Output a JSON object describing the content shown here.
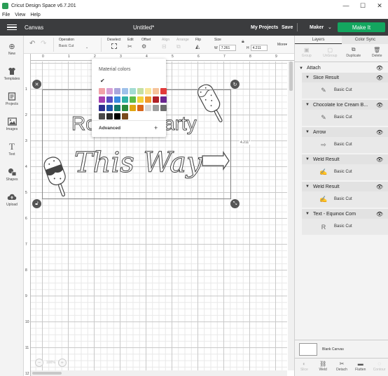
{
  "window": {
    "title": "Cricut Design Space  v6.7.201",
    "minimize": "—",
    "maximize": "☐",
    "close": "✕"
  },
  "menu": [
    "File",
    "View",
    "Help"
  ],
  "header": {
    "section": "Canvas",
    "doc_title": "Untitled*",
    "my_projects": "My Projects",
    "save": "Save",
    "machine": "Maker",
    "make_it": "Make It",
    "accent_color": "#13a65f"
  },
  "leftbar": [
    {
      "label": "New",
      "icon": "plus-icon",
      "glyph": "⊕"
    },
    {
      "label": "Templates",
      "icon": "shirt-icon",
      "glyph": "👕"
    },
    {
      "label": "Projects",
      "icon": "projects-icon",
      "glyph": "▤"
    },
    {
      "label": "Images",
      "icon": "image-icon",
      "glyph": "▨"
    },
    {
      "label": "Text",
      "icon": "text-icon",
      "glyph": "T"
    },
    {
      "label": "Shapes",
      "icon": "shapes-icon",
      "glyph": "◈"
    },
    {
      "label": "Upload",
      "icon": "upload-icon",
      "glyph": "☁"
    }
  ],
  "toolbar": {
    "undo": "↶",
    "redo": "↷",
    "operation_label": "Operation",
    "operation_value": "Basic Cut",
    "deselect": "Deselect",
    "edit": "Edit",
    "offset": "Offset",
    "align": "Align",
    "arrange": "Arrange",
    "flip": "Flip",
    "size": "Size",
    "w_label": "W",
    "w_value": "7.261",
    "h_label": "H",
    "h_value": "4.211",
    "more": "More▾"
  },
  "ruler_top": [
    "0",
    "1",
    "2",
    "3",
    "4",
    "5",
    "6",
    "7",
    "8",
    "9"
  ],
  "ruler_left": [
    "1",
    "2",
    "3",
    "4",
    "5",
    "6",
    "7",
    "8",
    "9",
    "10",
    "11",
    "12"
  ],
  "canvas": {
    "dimension_label": "4.211\"",
    "design_text_1": "Ro",
    "design_text_2": "arty",
    "design_script": "This Way"
  },
  "popup": {
    "title": "Material colors",
    "advanced": "Advanced",
    "check": "✔",
    "plus": "+",
    "swatches": [
      "#f2a2a8",
      "#d7a0d6",
      "#a9a6dc",
      "#9ec1ea",
      "#a3dcd3",
      "#c5e0a2",
      "#f8e69a",
      "#f6c39b",
      "#e23a3a",
      "#a63fb0",
      "#5a4fc2",
      "#3a8be0",
      "#2fb1a6",
      "#5fbb46",
      "#f3d23b",
      "#f19a30",
      "#b12027",
      "#6a2590",
      "#2c2f8f",
      "#1f56a8",
      "#137a6b",
      "#2c8a3c",
      "#e0a512",
      "#d9661a",
      "#d6d6d6",
      "#9e9e9e",
      "#6d6d6d",
      "#4a4a4a",
      "#2a2a2a",
      "#000000",
      "#7a4a1c",
      ""
    ]
  },
  "right_panel": {
    "tabs": [
      "Layers",
      "Color Sync"
    ],
    "actions": [
      {
        "label": "Group",
        "icon": "group-icon",
        "disabled": true
      },
      {
        "label": "UnGroup",
        "icon": "ungroup-icon",
        "disabled": true
      },
      {
        "label": "Duplicate",
        "icon": "duplicate-icon",
        "disabled": false
      },
      {
        "label": "Delete",
        "icon": "delete-icon",
        "disabled": false
      }
    ],
    "attach_label": "Attach",
    "layers": [
      {
        "name": "Slice Result",
        "child": "Basic Cut",
        "thumb": "✎"
      },
      {
        "name": "Chocolate Ice Cream B...",
        "child": "Basic Cut",
        "thumb": "✎"
      },
      {
        "name": "Arrow",
        "child": "Basic Cut",
        "thumb": "⇨"
      },
      {
        "name": "Weld Result",
        "child": "Basic Cut",
        "thumb": "✍"
      },
      {
        "name": "Weld Result",
        "child": "Basic Cut",
        "thumb": "✍"
      },
      {
        "name": "Text - Equinox Com",
        "child": "Basic Cut",
        "thumb": "R"
      }
    ],
    "blank_canvas": "Blank Canvas",
    "bottom_actions": [
      {
        "label": "Slice",
        "icon": "slice-icon",
        "disabled": true
      },
      {
        "label": "Weld",
        "icon": "weld-icon",
        "disabled": false
      },
      {
        "label": "Detach",
        "icon": "detach-icon",
        "disabled": false
      },
      {
        "label": "Flatten",
        "icon": "flatten-icon",
        "disabled": false
      },
      {
        "label": "Contour",
        "icon": "contour-icon",
        "disabled": true
      }
    ]
  },
  "zoom": {
    "value": "100%",
    "minus": "−",
    "plus": "+"
  }
}
